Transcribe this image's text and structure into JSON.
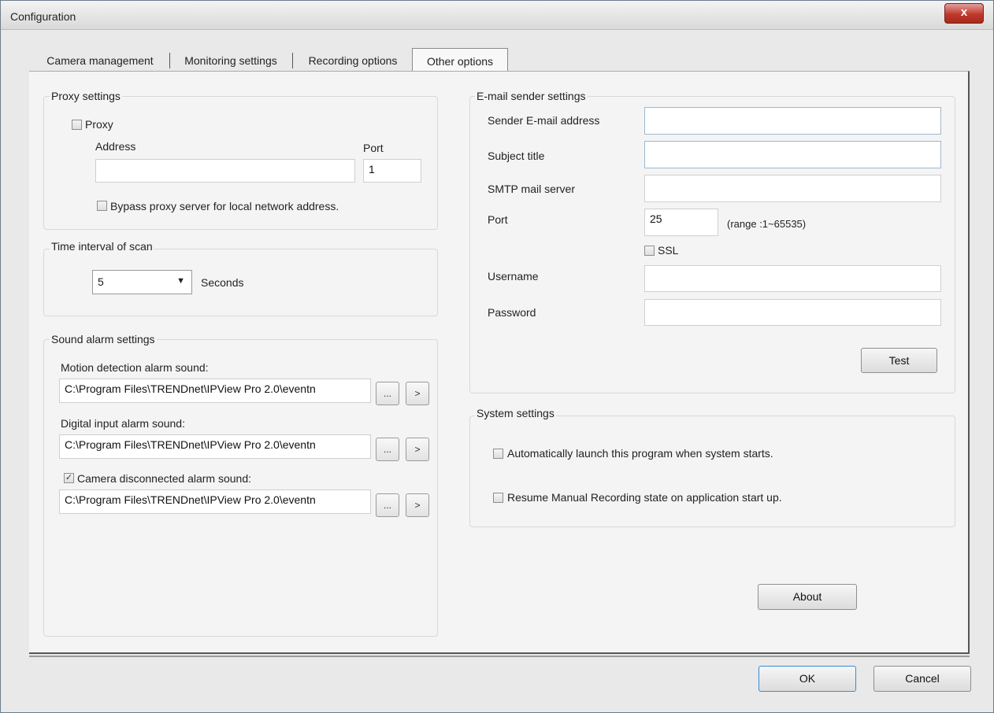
{
  "window": {
    "title": "Configuration",
    "close_glyph": "x"
  },
  "tabs": [
    {
      "label": "Camera management"
    },
    {
      "label": "Monitoring settings"
    },
    {
      "label": "Recording options"
    },
    {
      "label": "Other options",
      "active": true
    }
  ],
  "proxy": {
    "group_label": "Proxy settings",
    "checkbox_label": "Proxy",
    "address_label": "Address",
    "address_value": "",
    "port_label": "Port",
    "port_value": "1",
    "bypass_label": "Bypass proxy server for local network address."
  },
  "scan": {
    "group_label": "Time interval of scan",
    "value": "5",
    "unit_label": "Seconds"
  },
  "sound": {
    "group_label": "Sound alarm settings",
    "motion_label": "Motion detection alarm sound:",
    "motion_path": "C:\\Program Files\\TRENDnet\\IPView Pro 2.0\\eventn",
    "digital_label": "Digital input alarm sound:",
    "digital_path": "C:\\Program Files\\TRENDnet\\IPView Pro 2.0\\eventn",
    "disconnect_label": "Camera disconnected alarm sound:",
    "disconnect_checked": true,
    "disconnect_path": "C:\\Program Files\\TRENDnet\\IPView Pro 2.0\\eventn",
    "browse_label": "...",
    "play_label": ">"
  },
  "email": {
    "group_label": "E-mail sender settings",
    "sender_label": "Sender E-mail address",
    "sender_value": "",
    "subject_label": "Subject title",
    "subject_value": "",
    "smtp_label": "SMTP mail server",
    "smtp_value": "",
    "port_label": "Port",
    "port_value": "25",
    "port_range": "(range :1~65535)",
    "ssl_label": "SSL",
    "username_label": "Username",
    "username_value": "",
    "password_label": "Password",
    "password_value": "",
    "test_label": "Test"
  },
  "system": {
    "group_label": "System settings",
    "autolaunch_label": "Automatically launch this program when system starts.",
    "resume_label": "Resume Manual Recording state on application start up."
  },
  "buttons": {
    "about": "About",
    "ok": "OK",
    "cancel": "Cancel"
  }
}
